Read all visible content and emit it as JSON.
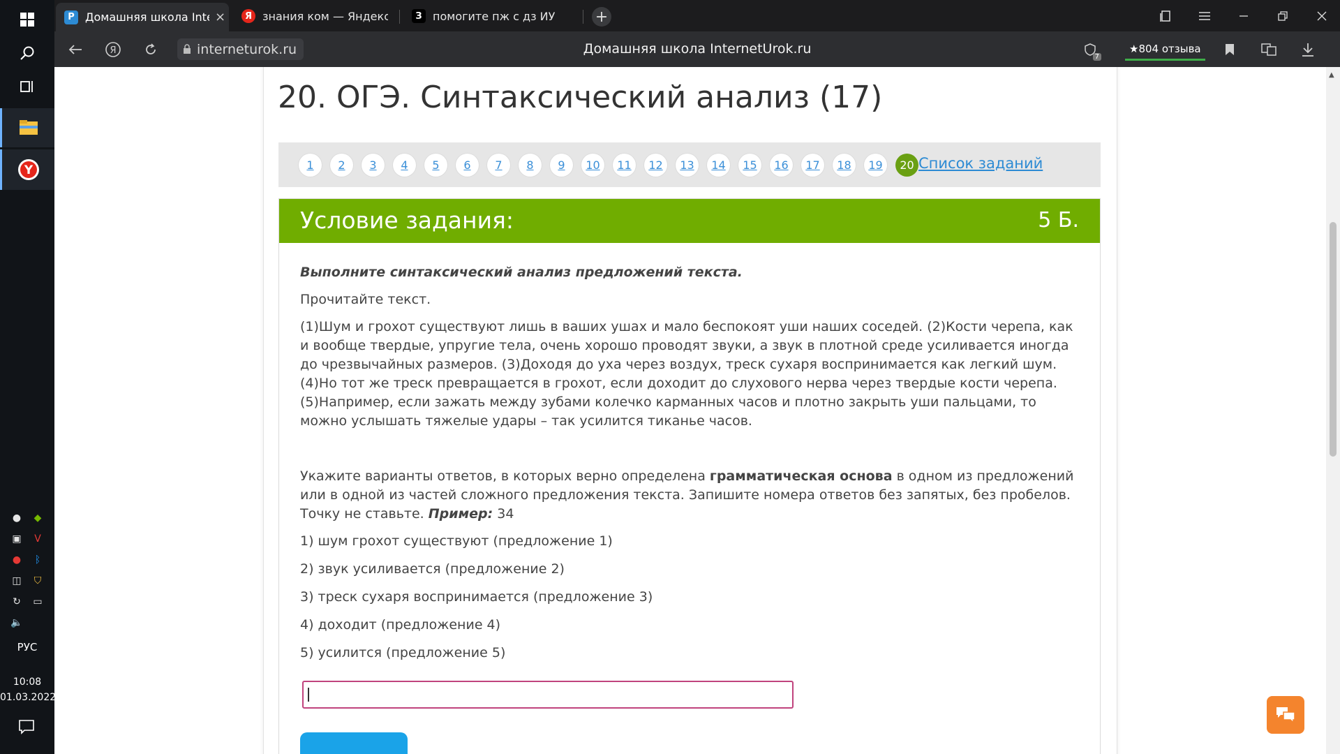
{
  "taskbar": {
    "tray_icons": [
      "discord-icon",
      "nvidia-icon",
      "screenshot-icon",
      "antivirus-icon",
      "yandex-icon",
      "bluetooth-icon",
      "camera-icon",
      "security-icon",
      "sync-icon",
      "monitor-icon",
      "volume-icon"
    ],
    "language": "РУС",
    "time": "10:08",
    "date": "01.03.2022"
  },
  "tabs": [
    {
      "title": "Домашняя школа InternetUrok.ru",
      "favicon": "P"
    },
    {
      "title": "знания ком — Яндекс: нашлось",
      "favicon": "Я"
    },
    {
      "title": "помогите пж с дз ИУ по Русскому",
      "favicon": "З"
    }
  ],
  "tab_close": "×",
  "newtab": "+",
  "address": {
    "url": "interneturok.ru",
    "page_title": "Домашняя школа InternetUrok.ru",
    "reviews": "★804 отзыва",
    "downloads_badge": "7"
  },
  "page": {
    "heading": "20. ОГЭ. Синтаксический анализ (17)",
    "pages": [
      "1",
      "2",
      "3",
      "4",
      "5",
      "6",
      "7",
      "8",
      "9",
      "10",
      "11",
      "12",
      "13",
      "14",
      "15",
      "16",
      "17",
      "18",
      "19",
      "20"
    ],
    "current_page": "20",
    "task_list_link": "Список заданий",
    "task": {
      "header": "Условие задания:",
      "points": "5 Б.",
      "instruction": "Выполните синтаксический анализ предложений текста.",
      "read": "Прочитайте текст.",
      "text": "(1)Шум и грохот существуют лишь в ваших ушах и мало беспокоят уши наших соседей. (2)Кости черепа, как и вообще твердые, упругие тела, очень хорошо проводят звуки, а звук в плотной среде усиливается иногда до чрезвычайных размеров. (3)Доходя до уха через воздух, треск сухаря воспринимается как легкий шум. (4)Но тот же треск превращается в грохот, если доходит до слухового нерва через твердые кости черепа. (5)Например, если зажать между зубами колечко карманных часов и плотно закрыть уши пальцами, то можно услышать тяжелые удары – так усилится тиканье часов.",
      "question_part1": "Укажите варианты ответов, в которых верно определена ",
      "question_bold": "грамматическая основа",
      "question_part2": " в одном из предложений или в одной из частей сложного предложения текста. Запишите номера ответов без запятых, без пробелов. Точку не ставьте. ",
      "example_label": "Пример:",
      "example_value": " 34",
      "options": [
        "1) шум грохот существуют (предложение 1)",
        "2) звук усиливается (предложение 2)",
        "3) треск сухаря воспринимается (предложение 3)",
        "4) доходит (предложение 4)",
        "5) усилится (предложение 5)"
      ],
      "answer_value": ""
    }
  },
  "colors": {
    "task_header": "#70ad00",
    "current_page": "#6aa012",
    "link": "#2d8bd4",
    "answer_border": "#c0437d",
    "submit": "#1aa3e8",
    "chat": "#f4842d"
  }
}
